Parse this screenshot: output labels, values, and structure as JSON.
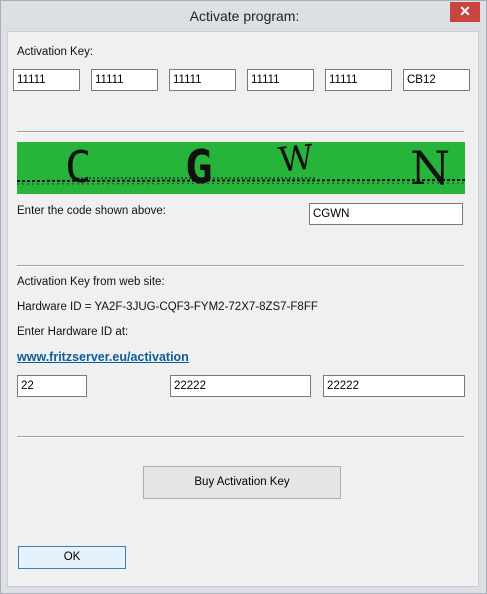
{
  "window": {
    "title": "Activate program:",
    "close_glyph": "✕"
  },
  "activation": {
    "label": "Activation Key:",
    "keys": [
      "11111",
      "11111",
      "11111",
      "11111",
      "11111",
      "CB12"
    ]
  },
  "captcha": {
    "letters": [
      "C",
      "G",
      "W",
      "N"
    ],
    "background": "#27b43b",
    "label": "Enter the code shown above:",
    "input_value": "CGWN"
  },
  "web": {
    "label": "Activation Key from web site:",
    "hardware_id_text": "Hardware ID = YA2F-3JUG-CQF3-FYM2-72X7-8ZS7-F8FF",
    "enter_label": "Enter Hardware ID at:",
    "link": "www.fritzserver.eu/activation",
    "fields": [
      "22",
      "22222",
      "22222"
    ]
  },
  "buttons": {
    "buy": "Buy Activation Key",
    "ok": "OK"
  },
  "colors": {
    "close_button": "#c7443f",
    "link": "#0a5e9e",
    "ok_border": "#3c7fb1"
  }
}
